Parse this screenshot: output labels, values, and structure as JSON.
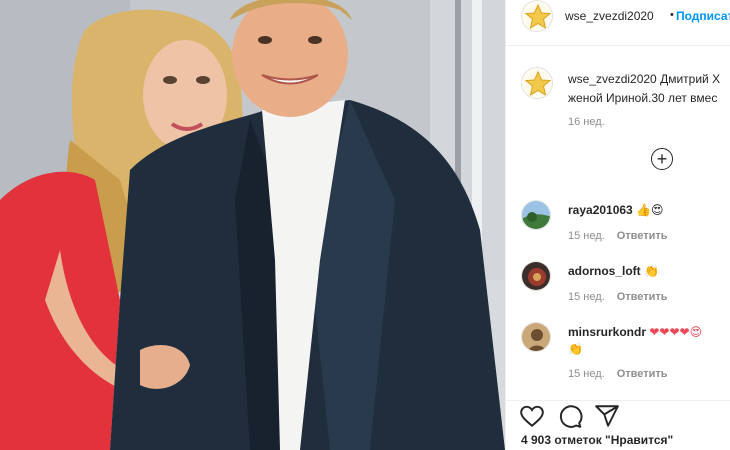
{
  "post": {
    "author": "wse_zvezdi2020",
    "follow_label": "Подписат",
    "separator": "•",
    "caption_user": "wse_zvezdi2020",
    "caption_line1": "Дмитрий Х",
    "caption_line2": "женой Ириной.30 лет вмес",
    "caption_time": "16 нед.",
    "load_more_icon": "plus-circle-icon",
    "likes_text": "4 903 отметок \"Нравится\""
  },
  "comments": [
    {
      "user": "raya201063",
      "emoji": "👍😍",
      "time": "15 нед.",
      "reply": "Ответить",
      "avatar_colors": [
        "#3f7a3a",
        "#9cc3e6"
      ]
    },
    {
      "user": "adornos_loft",
      "emoji": "👏",
      "time": "15 нед.",
      "reply": "Ответить",
      "avatar_colors": [
        "#3b2d2a",
        "#9b3b2d"
      ]
    },
    {
      "user": "minsrurkondr",
      "emoji": "❤❤❤❤😍",
      "emoji2": "👏",
      "time": "15 нед.",
      "reply": "Ответить",
      "avatar_colors": [
        "#caa87a",
        "#6a4e2f"
      ]
    }
  ],
  "actions": {
    "like_icon": "heart-icon",
    "comment_icon": "comment-icon",
    "share_icon": "share-icon"
  },
  "colors": {
    "accent": "#0095f6",
    "muted": "#8e8e8e",
    "border": "#efefef",
    "heart": "#ed4956"
  }
}
